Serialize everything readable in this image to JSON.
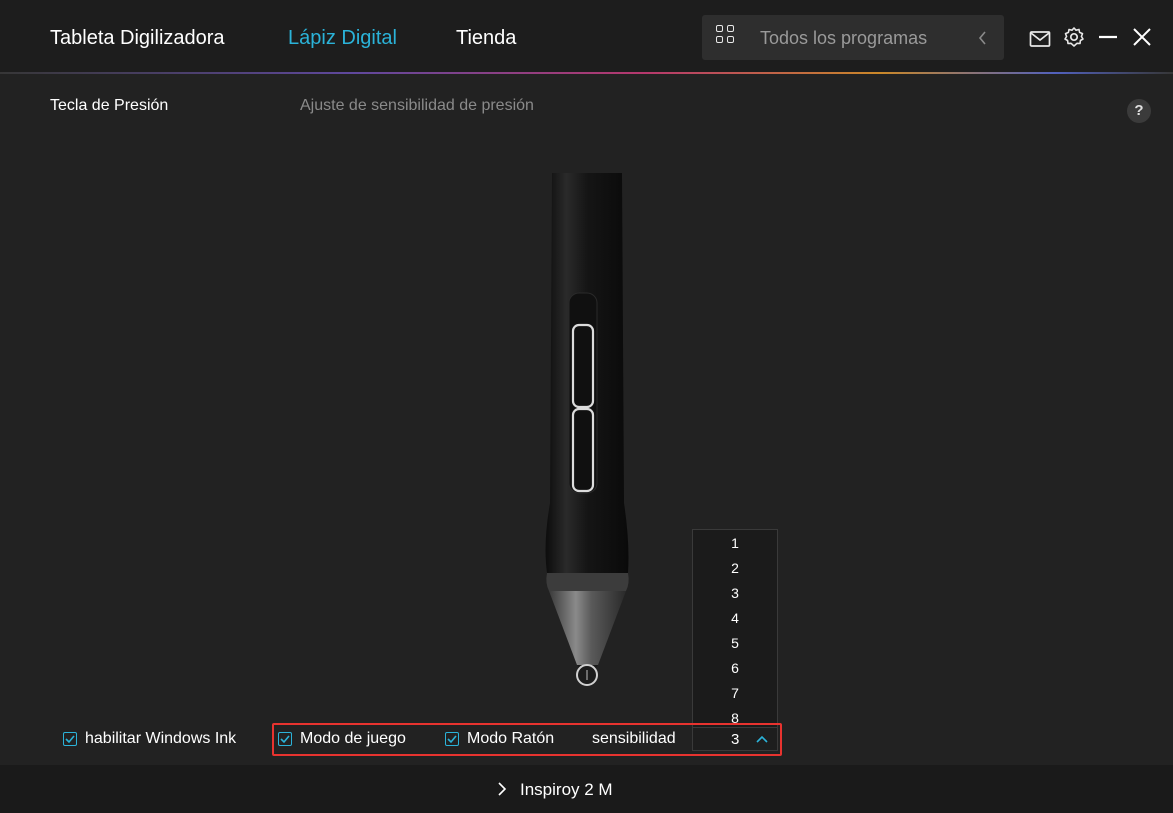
{
  "nav": {
    "tabs": [
      {
        "label": "Tableta Digilizadora",
        "active": false
      },
      {
        "label": "Lápiz Digital",
        "active": true
      },
      {
        "label": "Tienda",
        "active": false
      }
    ],
    "programs_label": "Todos los programas",
    "icons": [
      "apps-grid-icon",
      "chevron-left-icon",
      "mail-icon",
      "gear-icon",
      "minimize-icon",
      "close-icon"
    ]
  },
  "section": {
    "left_title": "Tecla de Presión",
    "subtitle": "Ajuste de sensibilidad de presión",
    "help": "?"
  },
  "options": {
    "windows_ink": "habilitar Windows Ink",
    "game_mode": "Modo de juego",
    "mouse_mode": "Modo Ratón",
    "sensitivity_label": "sensibilidad",
    "sensitivity_value": "3",
    "sensitivity_options": [
      "1",
      "2",
      "3",
      "4",
      "5",
      "6",
      "7",
      "8"
    ]
  },
  "footer": {
    "device": "Inspiroy 2 M"
  },
  "colors": {
    "accent": "#2bb3d9",
    "highlight_border": "#e8332f",
    "background": "#222222"
  }
}
